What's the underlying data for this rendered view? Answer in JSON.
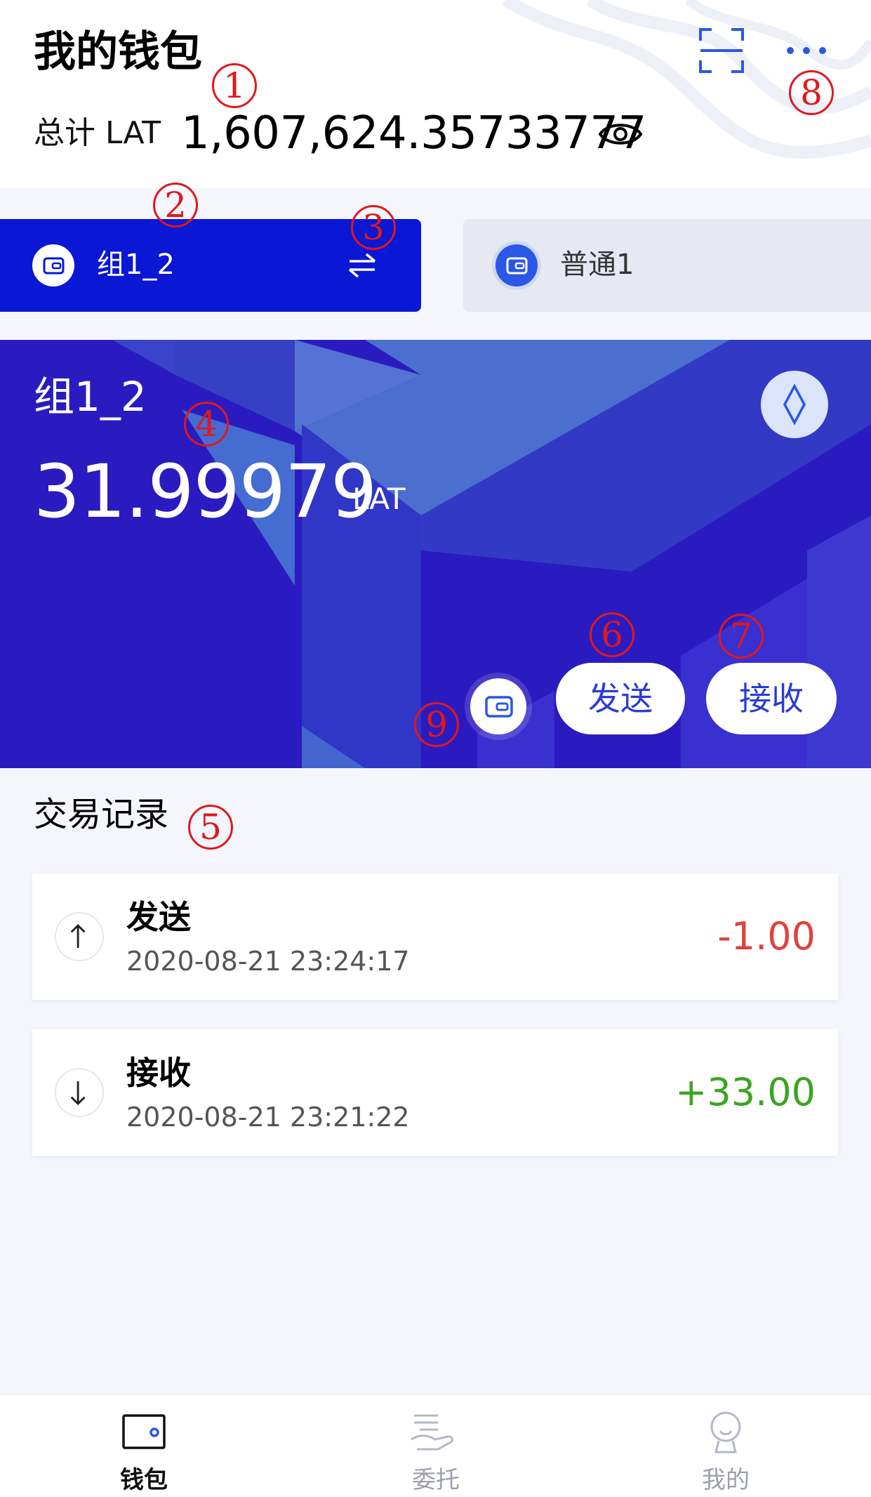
{
  "header": {
    "title": "我的钱包",
    "total_label": "总计 LAT",
    "total_value": "1,607,624.35733777"
  },
  "wallet_tabs": [
    {
      "label": "组1_2",
      "active": true
    },
    {
      "label": "普通1",
      "active": false
    }
  ],
  "card": {
    "name": "组1_2",
    "balance": "31.99979",
    "unit": "LAT",
    "send_label": "发送",
    "receive_label": "接收"
  },
  "records": {
    "title": "交易记录",
    "items": [
      {
        "type": "发送",
        "time": "2020-08-21 23:24:17",
        "amount": "-1.00",
        "direction": "out"
      },
      {
        "type": "接收",
        "time": "2020-08-21 23:21:22",
        "amount": "+33.00",
        "direction": "in"
      }
    ]
  },
  "annotations": [
    "1",
    "2",
    "3",
    "4",
    "5",
    "6",
    "7",
    "8",
    "9"
  ],
  "nav": {
    "items": [
      {
        "label": "钱包",
        "active": true,
        "icon": "wallet-icon"
      },
      {
        "label": "委托",
        "active": false,
        "icon": "delegate-hand-icon"
      },
      {
        "label": "我的",
        "active": false,
        "icon": "profile-icon"
      }
    ]
  },
  "colors": {
    "accent": "#0a17d4",
    "card_bg": "#2a1bc0",
    "send_amount": "#e0413c",
    "receive_amount": "#3aa520",
    "annotation": "#e0181c"
  }
}
